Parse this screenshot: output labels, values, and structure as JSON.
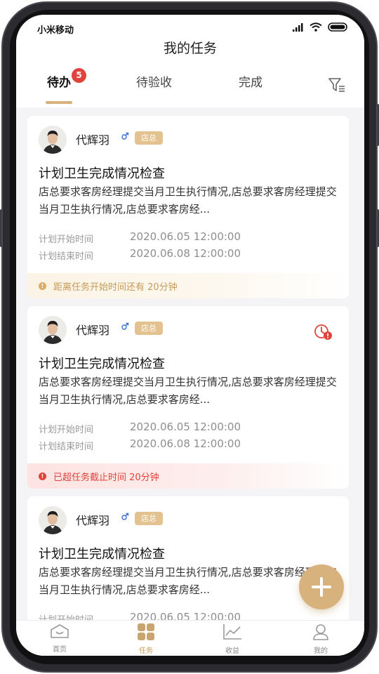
{
  "status_bar": {
    "carrier": "小米移动"
  },
  "header": {
    "title": "我的任务"
  },
  "tabs": [
    {
      "label": "待办",
      "badge": "5",
      "active": true
    },
    {
      "label": "待验收"
    },
    {
      "label": "完成"
    }
  ],
  "icons": {
    "filter": "filter-icon",
    "gender": "male-icon",
    "overdue": "clock-alert-icon",
    "add": "plus-icon"
  },
  "colors": {
    "accent": "#d7b27c",
    "badge": "#e0433c",
    "warning": "#e0433c",
    "info": "#c79a56"
  },
  "tasks": [
    {
      "name": "代辉羽",
      "role": "店总",
      "title": "计划卫生完成情况检查",
      "desc": "店总要求客房经理提交当月卫生执行情况,店总要求客房经理提交当月卫生执行情况,店总要求客房经...",
      "start_label": "计划开始时间",
      "start_time": "2020.06.05 12:00:00",
      "end_label": "计划结束时间",
      "end_time": "2020.06.08 12:00:00",
      "notice": "距离任务开始时间还有 20分钟",
      "notice_type": "info"
    },
    {
      "name": "代辉羽",
      "role": "店总",
      "title": "计划卫生完成情况检查",
      "desc": "店总要求客房经理提交当月卫生执行情况,店总要求客房经理提交当月卫生执行情况,店总要求客房经...",
      "start_label": "计划开始时间",
      "start_time": "2020.06.05 12:00:00",
      "end_label": "计划结束时间",
      "end_time": "2020.06.08 12:00:00",
      "notice": "已超任务截止时间 20分钟",
      "notice_type": "warn",
      "overdue": true
    },
    {
      "name": "代辉羽",
      "role": "店总",
      "title": "计划卫生完成情况检查",
      "desc": "店总要求客房经理提交当月卫生执行情况,店总要求客房经理提交当月卫生执行情况,店总要求客房经...",
      "start_label": "计划开始时间",
      "start_time": "2020.06.05 12:00:00"
    }
  ],
  "bottom_nav": [
    {
      "label": "首页",
      "icon": "home-icon"
    },
    {
      "label": "任务",
      "icon": "grid-icon",
      "active": true
    },
    {
      "label": "收益",
      "icon": "chart-icon"
    },
    {
      "label": "我的",
      "icon": "user-icon"
    }
  ]
}
